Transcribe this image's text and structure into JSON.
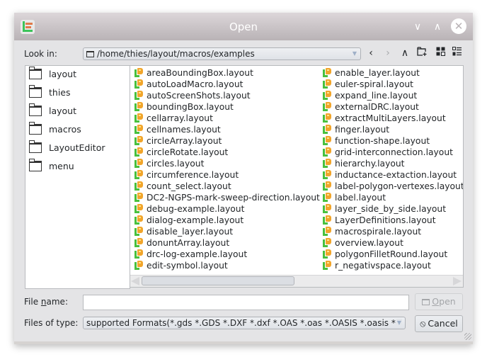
{
  "window": {
    "title": "Open",
    "minimize_glyph": "∨",
    "maximize_glyph": "∧",
    "close_glyph": "✕"
  },
  "look_in": {
    "label": "Look in:",
    "path": "/home/thies/layout/macros/examples",
    "nav": {
      "back_glyph": "‹",
      "forward_glyph": "›",
      "up_glyph": "∧",
      "new_folder_glyph": "⊕",
      "list_view_glyph": "▦",
      "detail_view_glyph": "☰"
    }
  },
  "sidebar": {
    "items": [
      {
        "label": "layout",
        "icon": "folder-icon"
      },
      {
        "label": "thies",
        "icon": "folder-icon"
      },
      {
        "label": "layout",
        "icon": "folder-icon"
      },
      {
        "label": "macros",
        "icon": "folder-icon"
      },
      {
        "label": "LayoutEditor",
        "icon": "folder-icon"
      },
      {
        "label": "menu",
        "icon": "folder-icon"
      }
    ]
  },
  "files": {
    "column1": [
      "areaBoundingBox.layout",
      "autoLoadMacro.layout",
      "autoScreenShots.layout",
      "boundingBox.layout",
      "cellarray.layout",
      "cellnames.layout",
      "circleArray.layout",
      "circleRotate.layout",
      "circles.layout",
      "circumference.layout",
      "count_select.layout",
      "DC2-NGPS-mark-sweep-direction.layout",
      "debug-example.layout",
      "dialog-example.layout",
      "disable_layer.layout",
      "donuntArray.layout",
      "drc-log-example.layout",
      "edit-symbol.layout"
    ],
    "column2": [
      "enable_layer.layout",
      "euler-spiral.layout",
      "expand_line.layout",
      "externalDRC.layout",
      "extractMultiLayers.layout",
      "finger.layout",
      "function-shape.layout",
      "grid-interconnection.layout",
      "hierarchy.layout",
      "inductance-extaction.layout",
      "label-polygon-vertexes.layout",
      "label.layout",
      "layer_side_by_side.layout",
      "LayerDefinitions.layout",
      "macrospirale.layout",
      "overview.layout",
      "polygonFilletRound.layout",
      "r_negativspace.layout"
    ],
    "horizontal_scroll_fraction": 0.46
  },
  "file_name": {
    "label": "File name:",
    "value": "",
    "placeholder": ""
  },
  "file_type": {
    "label": "Files of type:",
    "selected": "supported Formats(*.gds *.GDS *.DXF *.dxf *.OAS *.oas *.OASIS *.oasis *"
  },
  "buttons": {
    "open": "Open",
    "cancel": "Cancel",
    "open_icon_glyph": "",
    "cancel_icon_glyph": "⦸"
  }
}
